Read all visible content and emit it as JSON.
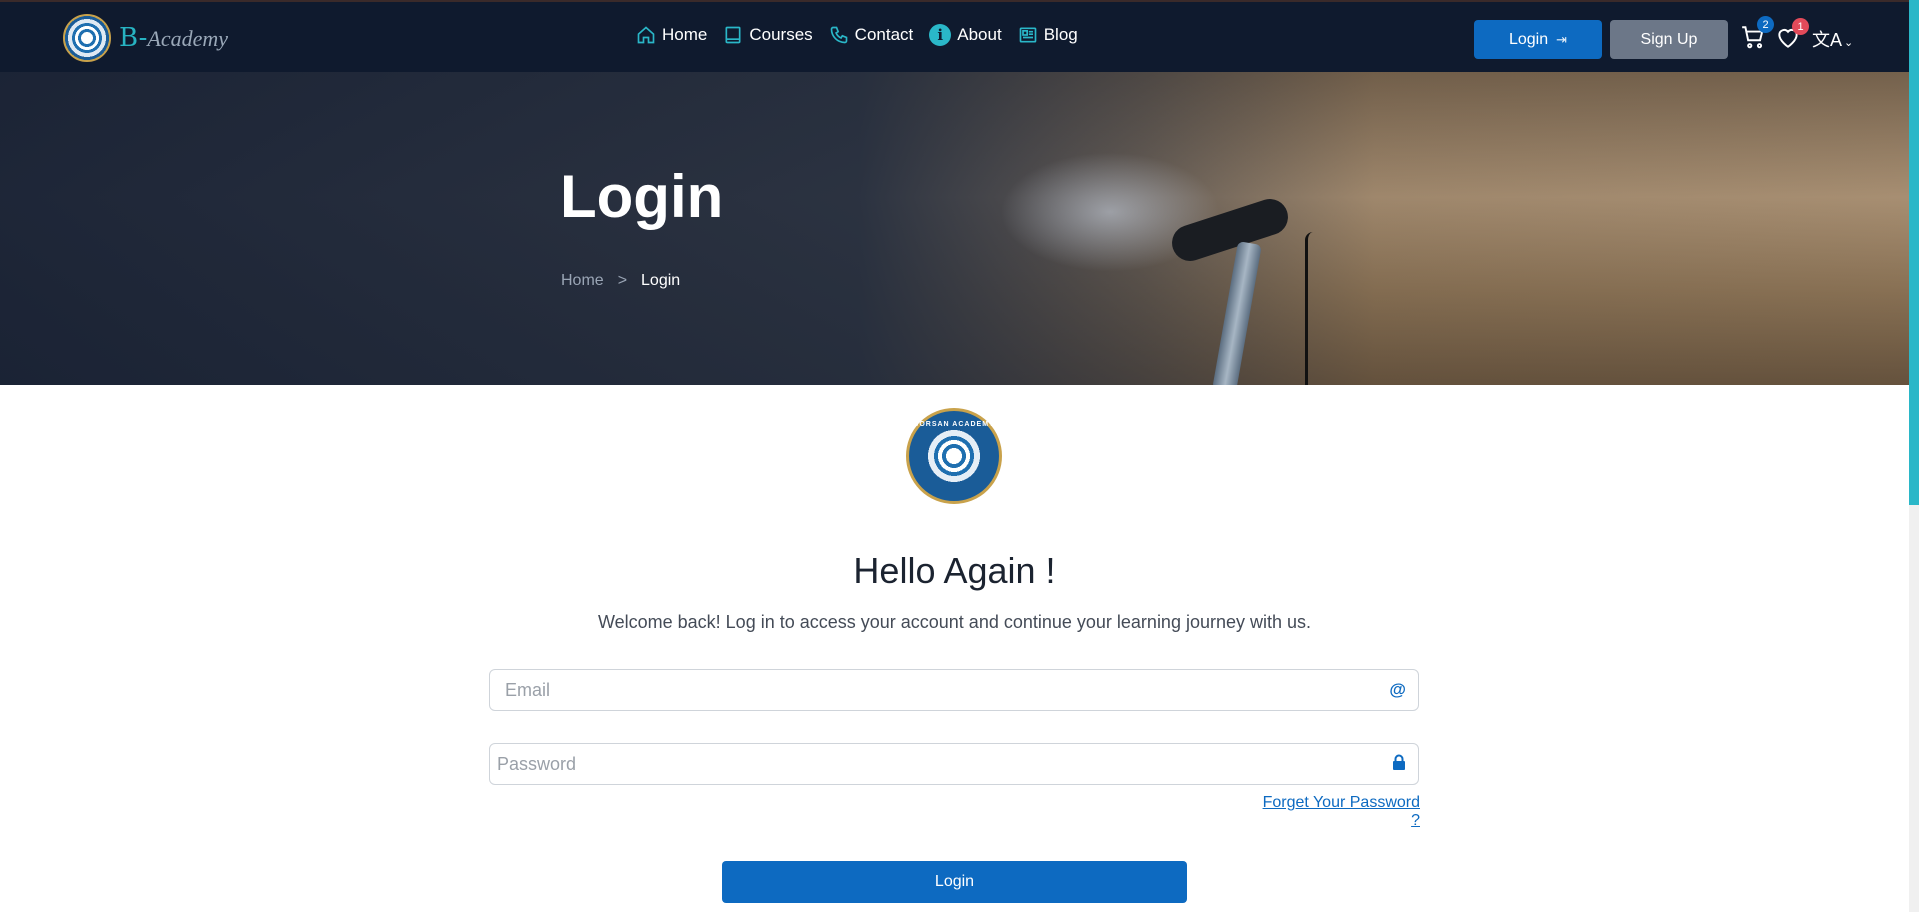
{
  "brand": {
    "name_prefix": "B-",
    "name_suffix": "Academy"
  },
  "nav": {
    "items": [
      {
        "label": "Home",
        "icon": "home-icon"
      },
      {
        "label": "Courses",
        "icon": "book-icon"
      },
      {
        "label": "Contact",
        "icon": "phone-icon"
      },
      {
        "label": "About",
        "icon": "info-icon"
      },
      {
        "label": "Blog",
        "icon": "newspaper-icon"
      }
    ],
    "info_glyph": "i"
  },
  "header_actions": {
    "login_label": "Login",
    "signup_label": "Sign Up",
    "cart_count": "2",
    "wishlist_count": "1",
    "lang_glyph": "文A"
  },
  "hero": {
    "title": "Login",
    "breadcrumb": {
      "home": "Home",
      "separator": ">",
      "current": "Login"
    }
  },
  "logo_badge": {
    "text": "BORSAN ACADEMY"
  },
  "login_form": {
    "heading": "Hello Again !",
    "subtitle": "Welcome back! Log in to access your account and continue your learning journey with us.",
    "email_placeholder": "Email",
    "email_icon": "@",
    "password_placeholder": "Password",
    "forgot_label": "Forget Your Password ?",
    "submit_label": "Login"
  },
  "colors": {
    "navbar_bg": "#0f1a2e",
    "primary": "#0d6ac1",
    "secondary_button": "#6c7788",
    "accent": "#2ab7c8",
    "badge_red": "#e24a5a"
  }
}
